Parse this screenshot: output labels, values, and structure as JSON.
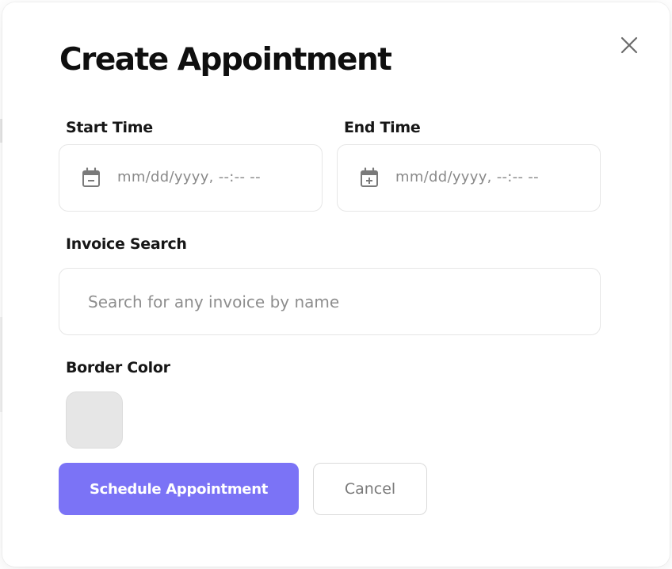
{
  "modal": {
    "title": "Create Appointment",
    "close_icon": "close-icon"
  },
  "start_time": {
    "label": "Start Time",
    "placeholder": "mm/dd/yyyy, --:-- --",
    "icon": "calendar-minus-icon"
  },
  "end_time": {
    "label": "End Time",
    "placeholder": "mm/dd/yyyy, --:-- --",
    "icon": "calendar-plus-icon"
  },
  "invoice_search": {
    "label": "Invoice Search",
    "value": "",
    "placeholder": "Search for any invoice by name"
  },
  "border_color": {
    "label": "Border Color",
    "value": "#e6e6e6"
  },
  "actions": {
    "schedule_label": "Schedule Appointment",
    "cancel_label": "Cancel"
  },
  "colors": {
    "primary": "#7b73f6",
    "text": "#0f0f0f",
    "muted": "#8a8a8a",
    "border": "#e6e6e6"
  }
}
